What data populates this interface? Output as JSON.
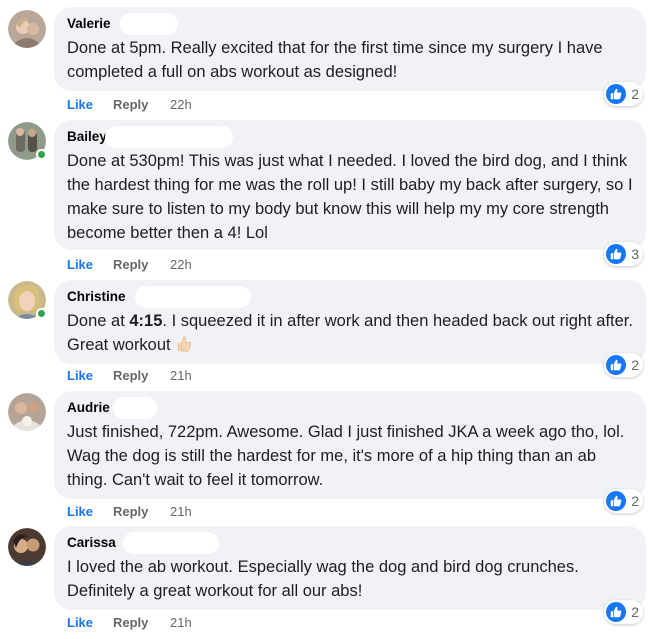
{
  "colors": {
    "accent": "#1877f2",
    "bubble": "#f0f2f5",
    "muted": "#65676b",
    "online": "#31a24c"
  },
  "comments": [
    {
      "author": "Valerie",
      "text": "Done at 5pm. Really excited that for the first time since my surgery I have completed a full on abs workout as designed!",
      "like_label": "Like",
      "reply_label": "Reply",
      "time": "22h",
      "reaction_icon": "like-icon",
      "reaction_count": "2",
      "online": false
    },
    {
      "author": "Bailey",
      "text": "Done at 530pm! This was just what I needed. I loved the bird dog, and I think the hardest thing for me was the roll up! I still baby my back after surgery, so I make sure to listen to my body but know this will help my my core strength become better then a 4! Lol",
      "like_label": "Like",
      "reply_label": "Reply",
      "time": "22h",
      "reaction_icon": "like-icon",
      "reaction_count": "3",
      "online": true
    },
    {
      "author": "Christine",
      "text_before": "Done at ",
      "text_bold": "4:15",
      "text_after": ". I squeezed it in after work and then headed back out right after. Great workout",
      "emoji": "thumbs-up-emoji",
      "like_label": "Like",
      "reply_label": "Reply",
      "time": "21h",
      "reaction_icon": "like-icon",
      "reaction_count": "2",
      "online": true
    },
    {
      "author": "Audrie",
      "text": "Just finished, 722pm. Awesome. Glad I just finished JKA a week ago tho, lol. Wag the dog is still the hardest for me, it's more of a hip thing than an ab thing. Can't wait to feel it tomorrow.",
      "like_label": "Like",
      "reply_label": "Reply",
      "time": "21h",
      "reaction_icon": "like-icon",
      "reaction_count": "2",
      "online": false
    },
    {
      "author": "Carissa",
      "text": "I loved the ab workout. Especially wag the dog and bird dog crunches. Definitely a great workout for all our abs!",
      "like_label": "Like",
      "reply_label": "Reply",
      "time": "21h",
      "reaction_icon": "like-icon",
      "reaction_count": "2",
      "online": false
    }
  ]
}
